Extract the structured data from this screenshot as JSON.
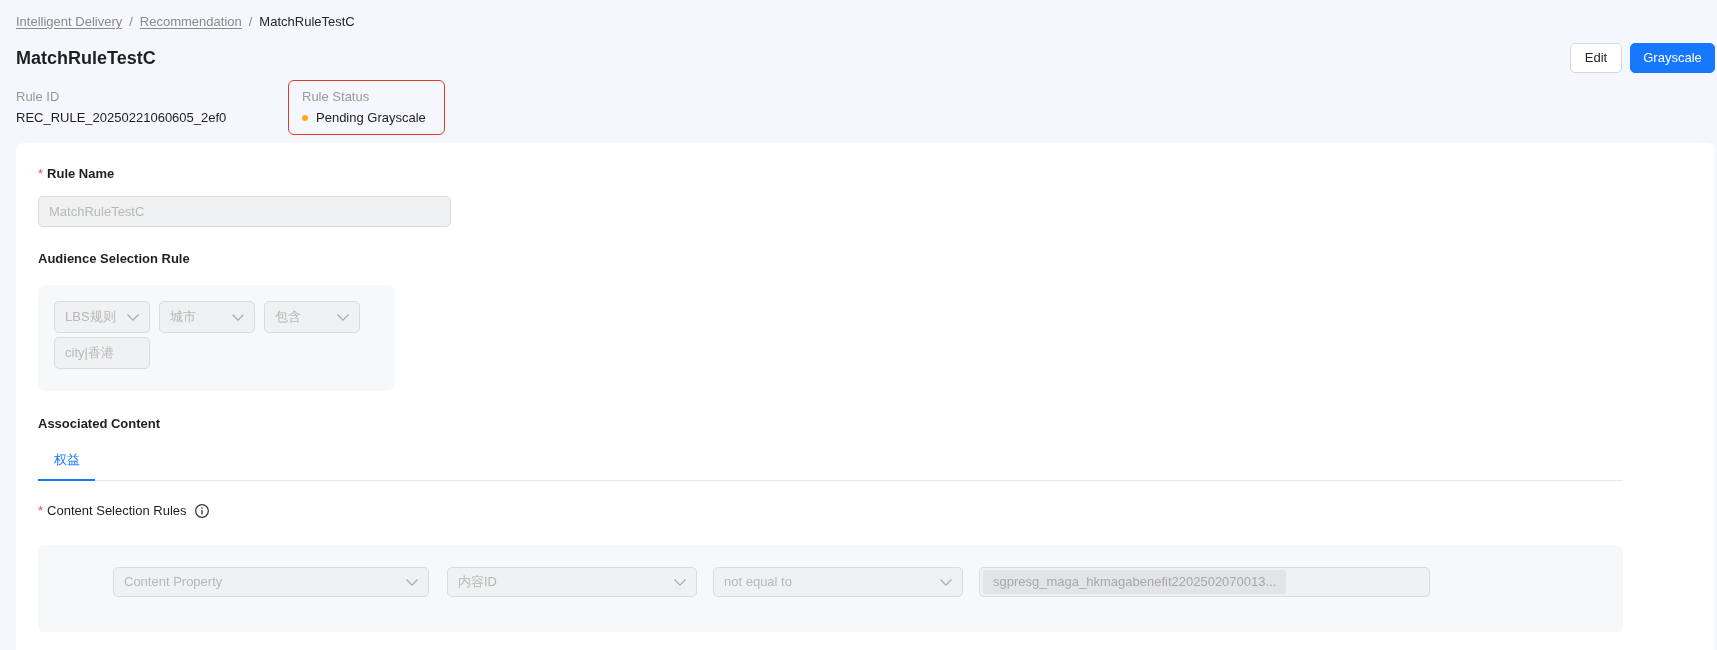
{
  "breadcrumb": [
    {
      "kind": "link",
      "label": "Intelligent Delivery"
    },
    {
      "kind": "separator",
      "label": "/"
    },
    {
      "kind": "link",
      "label": "Recommendation"
    },
    {
      "kind": "separator",
      "label": "/"
    },
    {
      "kind": "current",
      "label": "MatchRuleTestC"
    }
  ],
  "title": "MatchRuleTestC",
  "actions": [
    {
      "kind": "secondary",
      "label": "Edit"
    },
    {
      "kind": "primary",
      "label": "Grayscale"
    }
  ],
  "info": [
    {
      "label": "Rule ID",
      "value": "REC_RULE_20250221060605_2ef0",
      "highlighted": false
    },
    {
      "label": "Rule Status",
      "value": "Pending Grayscale",
      "color": "#faad14",
      "highlighted": true
    }
  ],
  "rule_name": {
    "required_mark": "*",
    "label": "Rule Name",
    "field": {
      "kind": "input",
      "value": "MatchRuleTestC",
      "disabled": true
    }
  },
  "audience": {
    "label": "Audience Selection Rule",
    "conditions": [
      {
        "kind": "select",
        "value": "LBS规则",
        "disabled": true
      },
      {
        "kind": "select",
        "value": "城市",
        "disabled": true
      },
      {
        "kind": "select",
        "value": "包含",
        "disabled": true
      },
      {
        "kind": "input",
        "value": "city|香港",
        "disabled": true
      }
    ]
  },
  "associated_content": {
    "label": "Associated Content",
    "tabs": [
      {
        "label": "权益",
        "selected": true
      }
    ],
    "content_rules": {
      "required_mark": "*",
      "label": "Content Selection Rules",
      "fields": [
        {
          "kind": "select",
          "value": "Content Property",
          "disabled": true
        },
        {
          "kind": "select",
          "value": "内容ID",
          "disabled": true
        },
        {
          "kind": "select",
          "value": "not equal to",
          "disabled": true
        },
        {
          "kind": "tags",
          "tags": [
            "sgpresg_maga_hkmagabenefit2202502070013..."
          ],
          "disabled": true
        }
      ]
    }
  }
}
